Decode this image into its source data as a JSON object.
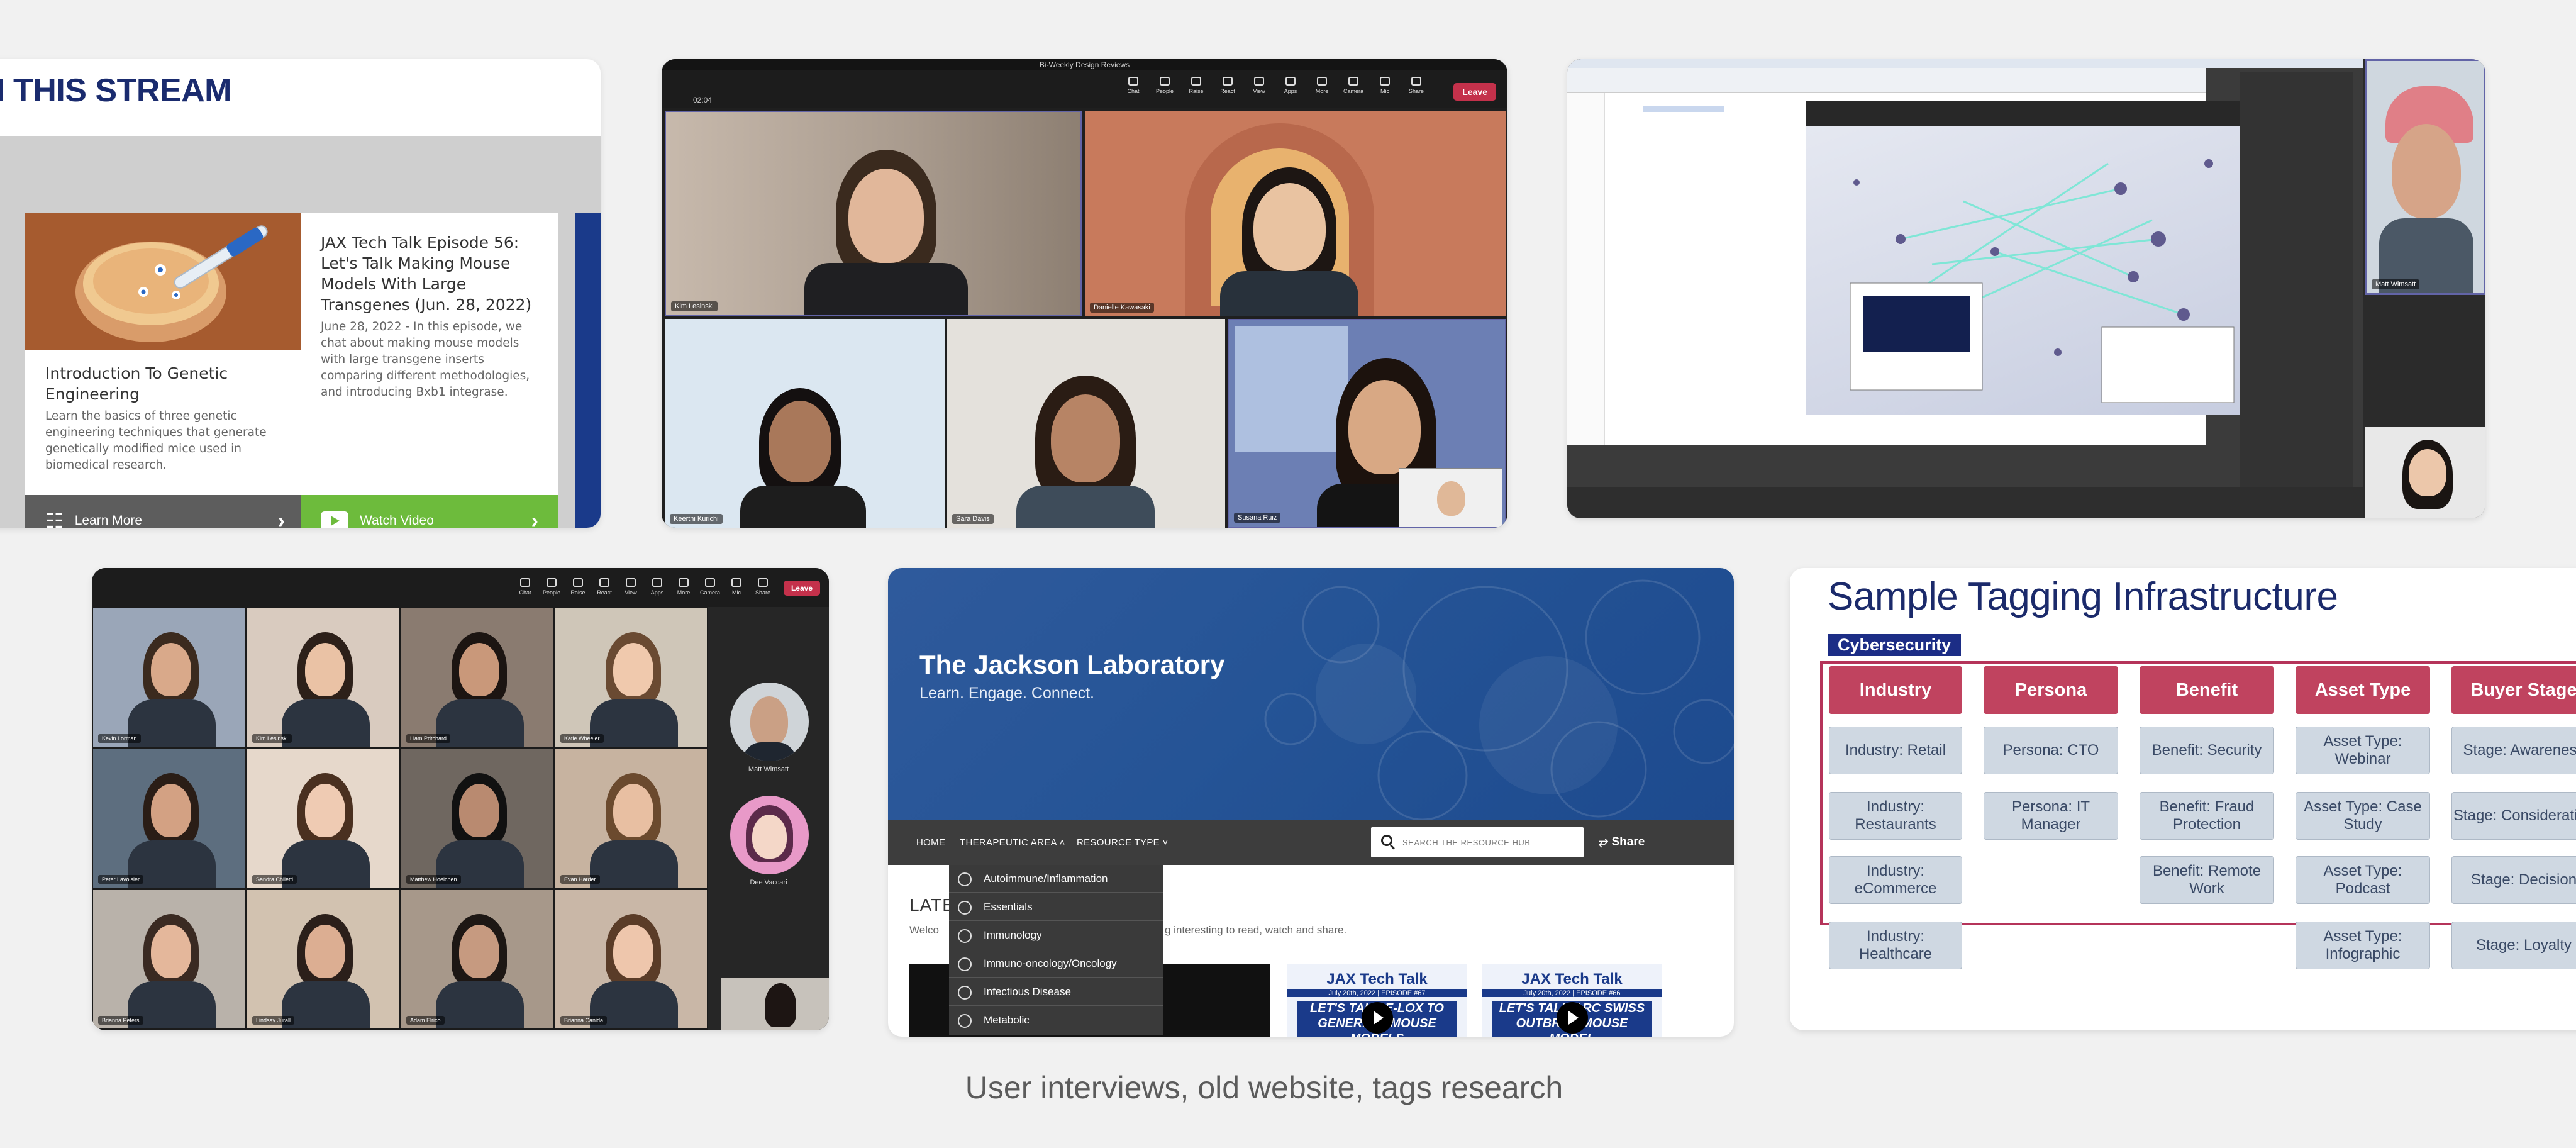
{
  "stream_card": {
    "heading": "N THIS STREAM",
    "cards": [
      {
        "title": "Introduction To Genetic Engineering",
        "description": "Learn the basics of three genetic engineering techniques that generate genetically modified mice used in biomedical research.",
        "action": "Learn More"
      },
      {
        "title": "JAX Tech Talk Episode 56: Let's Talk Making Mouse Models With Large Transgenes (Jun. 28, 2022)",
        "description": "June 28, 2022 - In this episode, we chat about making mouse models with large transgene inserts comparing different methodologies, and introducing Bxb1 integrase.",
        "action": "Watch Video"
      }
    ]
  },
  "teams_call": {
    "window_title": "Bi-Weekly Design Reviews",
    "timer": "02:04",
    "toolbar": [
      "Chat",
      "People",
      "Raise",
      "React",
      "View",
      "Apps",
      "More",
      "Camera",
      "Mic",
      "Share"
    ],
    "leave_label": "Leave",
    "participants": [
      "Kim Lesinski",
      "Danielle Kawasaki",
      "Keerthi Kurichi",
      "Sara Davis",
      "Susana Ruiz"
    ]
  },
  "screen_share": {
    "participant": "Matt Wimsatt"
  },
  "zoom_call": {
    "toolbar": [
      "Chat",
      "People",
      "Raise",
      "React",
      "View",
      "Apps",
      "More",
      "Camera",
      "Mic",
      "Share"
    ],
    "leave_label": "Leave",
    "participants": [
      "Kevin Lorman",
      "Kim Lesinski",
      "Liam Pritchard",
      "Katie Wheeler",
      "Peter Lavoisier",
      "Sandra Chiletti",
      "Matthew Hoelchen",
      "Evan Harder",
      "Brianna Peters",
      "Lindsay Jurall",
      "Adam Elrico",
      "Brianna Canida"
    ],
    "side_participants": [
      "Matt Wimsatt",
      "Dee Vaccari"
    ]
  },
  "resource_hub": {
    "title": "The Jackson Laboratory",
    "tagline": "Learn. Engage. Connect.",
    "nav": [
      "HOME",
      "THERAPEUTIC AREA",
      "RESOURCE TYPE"
    ],
    "search_placeholder": "SEARCH THE RESOURCE HUB",
    "share_label": "Share",
    "latest": "LATE",
    "welcome_a": "Welco",
    "welcome_b": "g interesting to read, watch and share.",
    "dropdown": [
      "Autoimmune/Inflammation",
      "Essentials",
      "Immunology",
      "Immuno-oncology/Oncology",
      "Infectious Disease",
      "Metabolic"
    ],
    "video_brand": "JAX Tech Talk",
    "videos": [
      {
        "date": "July 20th, 2022 | EPISODE #67",
        "headline": "LET'S TALK E-LOX TO GENERATE MOUSE MODELS"
      },
      {
        "date": "July 20th, 2022 | EPISODE #66",
        "headline": "LET'S TALK ARC SWISS OUTBRED MOUSE MODEL"
      }
    ]
  },
  "tagging": {
    "title": "Sample Tagging Infrastructure",
    "badge": "Cybersecurity",
    "headers": [
      "Industry",
      "Persona",
      "Benefit",
      "Asset Type",
      "Buyer Stage"
    ],
    "cells": {
      "industry": [
        "Industry: Retail",
        "Industry: Restaurants",
        "Industry: eCommerce",
        "Industry: Healthcare"
      ],
      "persona": [
        "Persona: CTO",
        "Persona: IT Manager"
      ],
      "benefit": [
        "Benefit: Security",
        "Benefit: Fraud Protection",
        "Benefit: Remote Work"
      ],
      "asset": [
        "Asset Type: Webinar",
        "Asset Type: Case Study",
        "Asset Type: Podcast",
        "Asset Type: Infographic"
      ],
      "stage": [
        "Stage: Awareness",
        "Stage: Consideration",
        "Stage: Decision",
        "Stage: Loyalty"
      ]
    }
  },
  "caption": "User interviews, old website, tags research",
  "colors": {
    "background": "#f1f1f1",
    "jax_navy": "#1a2b6e",
    "watch_green": "#6dbb3c",
    "leave_red": "#c4314b",
    "tag_header": "#c0435f",
    "tag_cell": "#cfd8e2"
  }
}
